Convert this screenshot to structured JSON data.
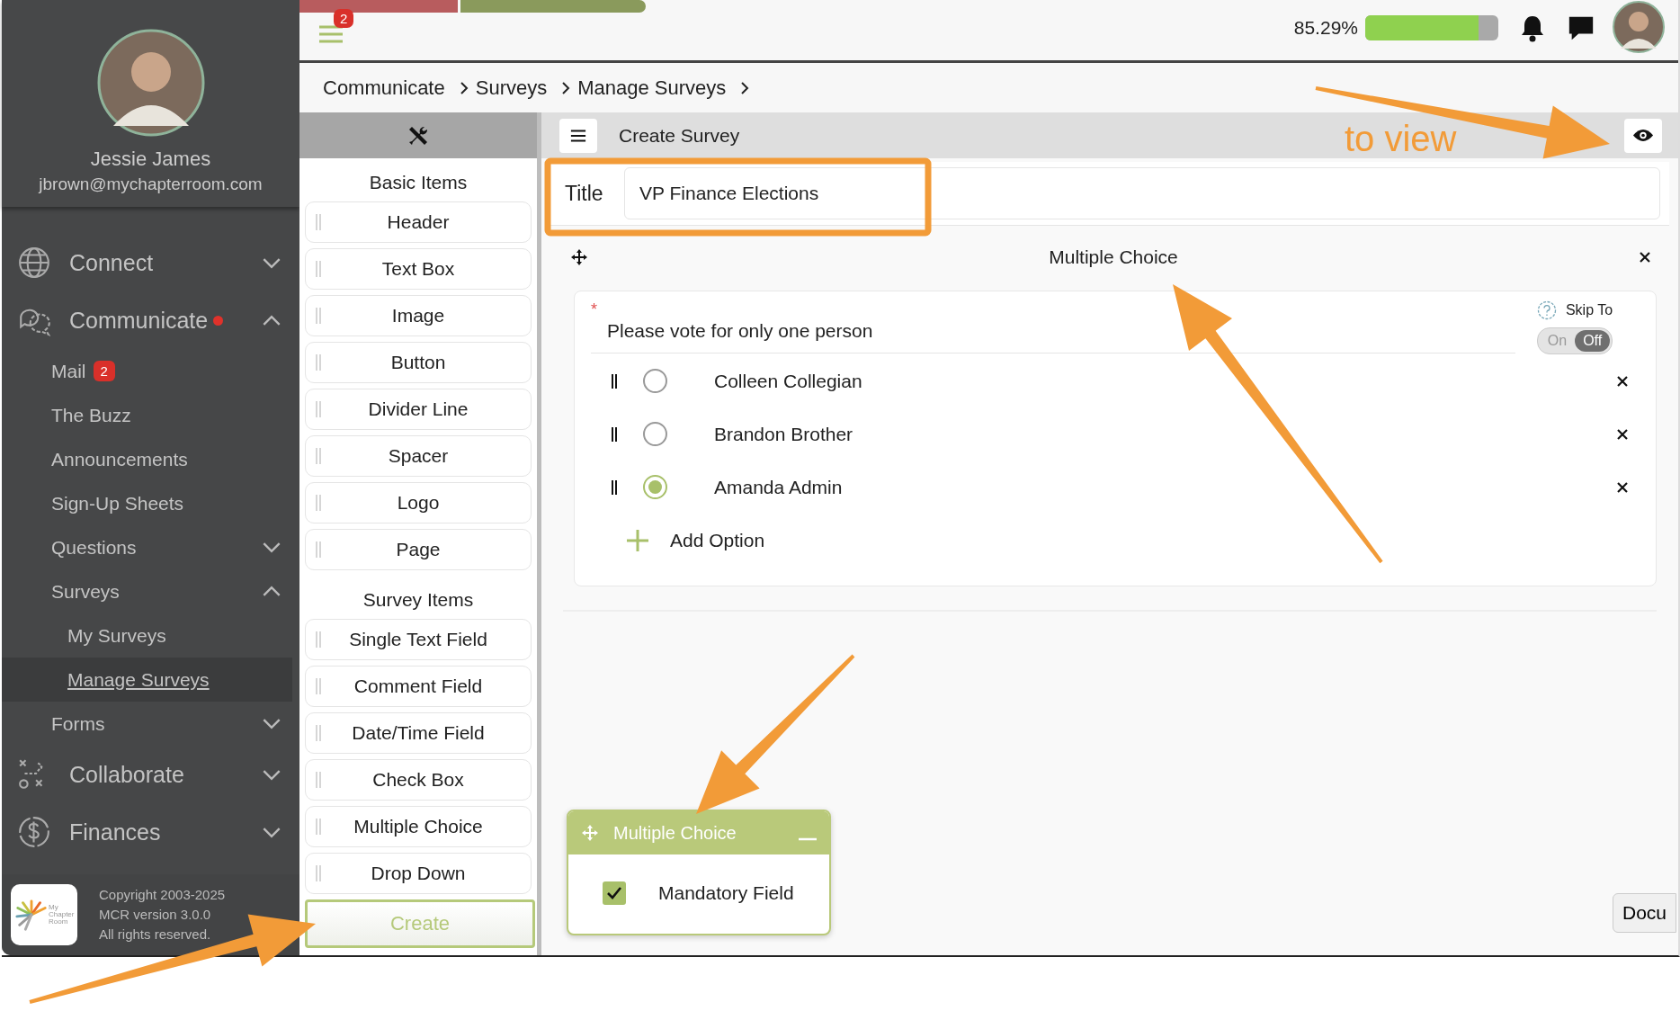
{
  "top_bar": {
    "menu_badge": "2",
    "progress": {
      "reading": "85.29%",
      "level": 0.85
    }
  },
  "profile": {
    "name": "Jessie James",
    "email": "jbrown@mychapterroom.com"
  },
  "sidebar": {
    "items": [
      {
        "label": "Connect",
        "expanded": false,
        "alert": false,
        "selected": false
      },
      {
        "label": "Communicate",
        "expanded": true,
        "alert": true,
        "selected": false,
        "children": [
          {
            "label": "Mail",
            "badge": "2",
            "selected": false
          },
          {
            "label": "The Buzz",
            "selected": false
          },
          {
            "label": "Announcements",
            "selected": false
          },
          {
            "label": "Sign-Up Sheets",
            "selected": false
          },
          {
            "label": "Questions",
            "expanded": false,
            "selected": false
          },
          {
            "label": "Surveys",
            "expanded": true,
            "selected": false,
            "children": [
              {
                "label": "My Surveys",
                "selected": false
              },
              {
                "label": "Manage Surveys",
                "selected": true
              }
            ]
          },
          {
            "label": "Forms",
            "expanded": false,
            "selected": false
          }
        ]
      },
      {
        "label": "Collaborate",
        "expanded": false,
        "alert": false,
        "selected": false
      },
      {
        "label": "Finances",
        "expanded": false,
        "alert": false,
        "selected": false
      }
    ]
  },
  "footer": {
    "logo_lines": [
      "My",
      "Chapter",
      "Room"
    ],
    "lines": [
      "Copyright 2003-2025",
      "MCR version 3.0.0",
      "All rights reserved."
    ]
  },
  "breadcrumb": [
    "Communicate",
    "Surveys",
    "Manage Surveys"
  ],
  "tools": {
    "groups": [
      {
        "heading": "Basic Items",
        "items": [
          "Header",
          "Text Box",
          "Image",
          "Button",
          "Divider Line",
          "Spacer",
          "Logo",
          "Page"
        ]
      },
      {
        "heading": "Survey Items",
        "items": [
          "Single Text Field",
          "Comment Field",
          "Date/Time Field",
          "Check Box",
          "Multiple Choice",
          "Drop Down"
        ]
      }
    ],
    "create_button": "Create"
  },
  "editor": {
    "title": "Create Survey",
    "title_field": {
      "label": "Title",
      "value": "VP Finance Elections"
    },
    "question": {
      "type_label": "Multiple Choice",
      "required": true,
      "required_mark": "*",
      "text": "Please vote for only one person",
      "skip_to": {
        "label": "Skip To",
        "on_label": "On",
        "off_label": "Off",
        "on": false
      },
      "options": [
        {
          "label": "Colleen Collegian",
          "selected": false
        },
        {
          "label": "Brandon Brother",
          "selected": false
        },
        {
          "label": "Amanda Admin",
          "selected": true
        }
      ],
      "add_label": "Add Option"
    }
  },
  "properties_panel": {
    "title": "Multiple Choice",
    "mandatory": {
      "label": "Mandatory Field",
      "checked": true
    }
  },
  "docs_button": "Docu",
  "annotations": {
    "note": "to view"
  }
}
